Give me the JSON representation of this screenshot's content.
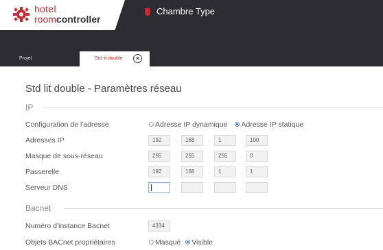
{
  "header": {
    "logo_line1": "hotel",
    "logo_line2_a": "room",
    "logo_line2_b": "controller",
    "context_title": "Chambre Type"
  },
  "tabs": [
    {
      "label": "Projet",
      "active": false
    },
    {
      "label": "Std lit double",
      "active": true
    }
  ],
  "page": {
    "title": "Std lit double - Paramètres réseau"
  },
  "ip_section": {
    "heading": "IP",
    "config_label": "Configuration de l'adresse",
    "config_options": [
      {
        "label": "Adresse IP dynamique",
        "selected": false
      },
      {
        "label": "Adresse IP statique",
        "selected": true
      }
    ],
    "rows": [
      {
        "label": "Adresses IP",
        "octets": [
          "192",
          "168",
          "1",
          "100"
        ]
      },
      {
        "label": "Masque de sous-réseau",
        "octets": [
          "255",
          "255",
          "255",
          "0"
        ]
      },
      {
        "label": "Passerelle",
        "octets": [
          "192",
          "168",
          "1",
          "1"
        ]
      },
      {
        "label": "Serveur DNS",
        "octets": [
          "",
          "",
          "",
          ""
        ]
      }
    ]
  },
  "bacnet_section": {
    "heading": "Bacnet",
    "instance_label": "Numéro d'instance Bacnet",
    "instance_value": "4334",
    "objects_label": "Objets BACnet propriétaires",
    "objects_options": [
      {
        "label": "Masqué",
        "selected": false
      },
      {
        "label": "Visible",
        "selected": true
      }
    ]
  },
  "colors": {
    "brand": "#c52b32",
    "header_bg": "#2c2c32",
    "radio_selected": "#4a78b4"
  }
}
